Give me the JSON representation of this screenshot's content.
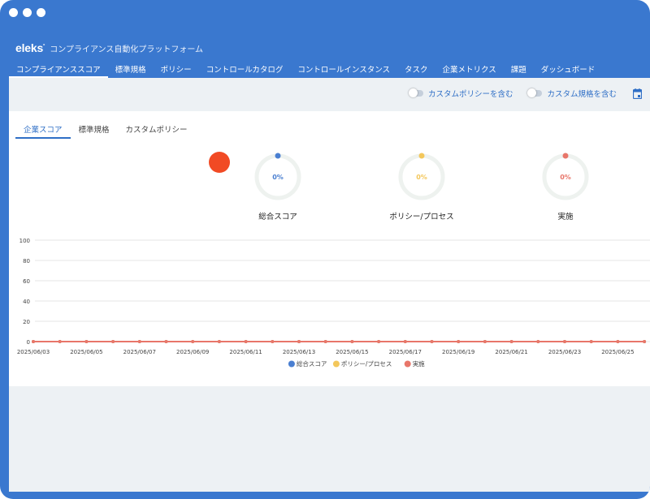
{
  "header": {
    "logo": "eleks",
    "app_title": "コンプライアンス自動化プラットフォーム"
  },
  "nav": {
    "tabs": [
      {
        "label": "コンプライアンススコア",
        "active": true
      },
      {
        "label": "標準規格",
        "active": false
      },
      {
        "label": "ポリシー",
        "active": false
      },
      {
        "label": "コントロールカタログ",
        "active": false
      },
      {
        "label": "コントロールインスタンス",
        "active": false
      },
      {
        "label": "タスク",
        "active": false
      },
      {
        "label": "企業メトリクス",
        "active": false
      },
      {
        "label": "課題",
        "active": false
      },
      {
        "label": "ダッシュボード",
        "active": false
      }
    ]
  },
  "toolbar": {
    "toggle_custom_policy": "カスタムポリシーを含む",
    "toggle_custom_standard": "カスタム規格を含む",
    "calendar_icon": "calendar-icon"
  },
  "subtabs": [
    {
      "label": "企業スコア",
      "active": true
    },
    {
      "label": "標準規格",
      "active": false
    },
    {
      "label": "カスタムポリシー",
      "active": false
    }
  ],
  "gauges": [
    {
      "label": "総合スコア",
      "value_text": "0%",
      "value": 0,
      "color": "#4a7fd1"
    },
    {
      "label": "ポリシー/プロセス",
      "value_text": "0%",
      "value": 0,
      "color": "#f3c75b"
    },
    {
      "label": "実施",
      "value_text": "0%",
      "value": 0,
      "color": "#e8766a"
    }
  ],
  "colors": {
    "accent": "#3a78cf",
    "alert_dot": "#f14a24"
  },
  "chart_data": {
    "type": "line",
    "ylim": [
      0,
      100
    ],
    "yticks": [
      0,
      20,
      40,
      60,
      80,
      100
    ],
    "x": [
      "2025/06/03",
      "2025/06/04",
      "2025/06/05",
      "2025/06/06",
      "2025/06/07",
      "2025/06/08",
      "2025/06/09",
      "2025/06/10",
      "2025/06/11",
      "2025/06/12",
      "2025/06/13",
      "2025/06/14",
      "2025/06/15",
      "2025/06/16",
      "2025/06/17",
      "2025/06/18",
      "2025/06/19",
      "2025/06/20",
      "2025/06/21",
      "2025/06/22",
      "2025/06/23",
      "2025/06/24",
      "2025/06/25",
      "2025/06/26"
    ],
    "xtick_labels": [
      "2025/06/03",
      "2025/06/05",
      "2025/06/07",
      "2025/06/09",
      "2025/06/11",
      "2025/06/13",
      "2025/06/15",
      "2025/06/17",
      "2025/06/19",
      "2025/06/21",
      "2025/06/23",
      "2025/06/25"
    ],
    "series": [
      {
        "name": "総合スコア",
        "color": "#4a7fd1",
        "values": [
          0,
          0,
          0,
          0,
          0,
          0,
          0,
          0,
          0,
          0,
          0,
          0,
          0,
          0,
          0,
          0,
          0,
          0,
          0,
          0,
          0,
          0,
          0,
          0
        ]
      },
      {
        "name": "ポリシー/プロセス",
        "color": "#f3c75b",
        "values": [
          0,
          0,
          0,
          0,
          0,
          0,
          0,
          0,
          0,
          0,
          0,
          0,
          0,
          0,
          0,
          0,
          0,
          0,
          0,
          0,
          0,
          0,
          0,
          0
        ]
      },
      {
        "name": "実施",
        "color": "#e8766a",
        "values": [
          0,
          0,
          0,
          0,
          0,
          0,
          0,
          0,
          0,
          0,
          0,
          0,
          0,
          0,
          0,
          0,
          0,
          0,
          0,
          0,
          0,
          0,
          0,
          0
        ]
      }
    ],
    "legend": "bottom-center",
    "grid": true
  }
}
